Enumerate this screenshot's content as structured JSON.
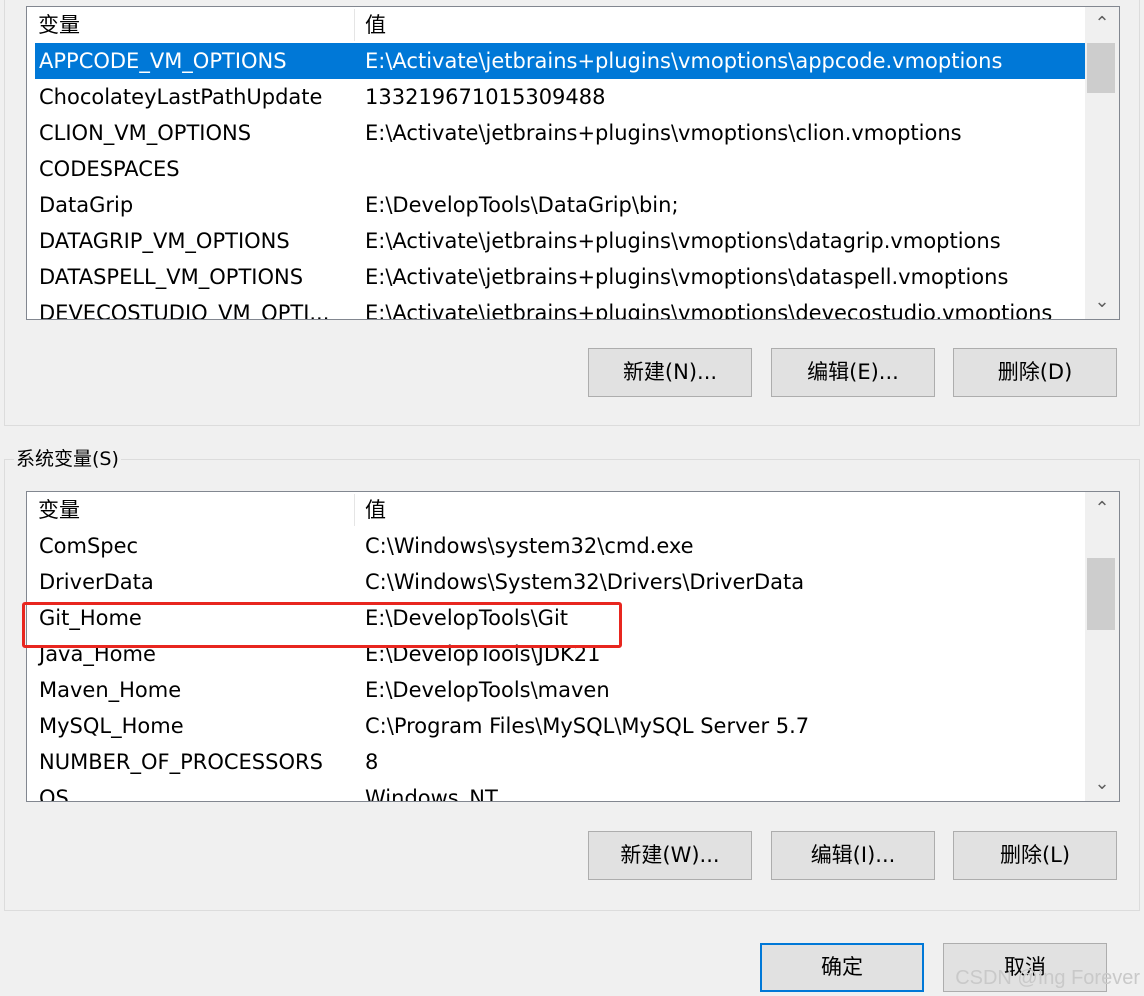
{
  "user_vars": {
    "header": {
      "name": "变量",
      "value": "值"
    },
    "rows": [
      {
        "name": "APPCODE_VM_OPTIONS",
        "value": "E:\\Activate\\jetbrains+plugins\\vmoptions\\appcode.vmoptions"
      },
      {
        "name": "ChocolateyLastPathUpdate",
        "value": "133219671015309488"
      },
      {
        "name": "CLION_VM_OPTIONS",
        "value": "E:\\Activate\\jetbrains+plugins\\vmoptions\\clion.vmoptions"
      },
      {
        "name": "CODESPACES",
        "value": ""
      },
      {
        "name": "DataGrip",
        "value": "E:\\DevelopTools\\DataGrip\\bin;"
      },
      {
        "name": "DATAGRIP_VM_OPTIONS",
        "value": "E:\\Activate\\jetbrains+plugins\\vmoptions\\datagrip.vmoptions"
      },
      {
        "name": "DATASPELL_VM_OPTIONS",
        "value": "E:\\Activate\\jetbrains+plugins\\vmoptions\\dataspell.vmoptions"
      },
      {
        "name": "DEVECOSTUDIO_VM_OPTI...",
        "value": "E:\\Activate\\jetbrains+plugins\\vmoptions\\devecostudio.vmoptions"
      }
    ],
    "buttons": {
      "new": "新建(N)...",
      "edit": "编辑(E)...",
      "delete": "删除(D)"
    }
  },
  "system_vars": {
    "group_label": "系统变量(S)",
    "header": {
      "name": "变量",
      "value": "值"
    },
    "rows": [
      {
        "name": "ComSpec",
        "value": "C:\\Windows\\system32\\cmd.exe"
      },
      {
        "name": "DriverData",
        "value": "C:\\Windows\\System32\\Drivers\\DriverData"
      },
      {
        "name": "Git_Home",
        "value": "E:\\DevelopTools\\Git"
      },
      {
        "name": "Java_Home",
        "value": "E:\\DevelopTools\\JDK21"
      },
      {
        "name": "Maven_Home",
        "value": "E:\\DevelopTools\\maven"
      },
      {
        "name": "MySQL_Home",
        "value": "C:\\Program Files\\MySQL\\MySQL Server 5.7"
      },
      {
        "name": "NUMBER_OF_PROCESSORS",
        "value": "8"
      },
      {
        "name": "OS",
        "value": "Windows_NT"
      }
    ],
    "buttons": {
      "new": "新建(W)...",
      "edit": "编辑(I)...",
      "delete": "删除(L)"
    }
  },
  "dialog_buttons": {
    "ok": "确定",
    "cancel": "取消"
  },
  "watermark": "CSDN @Ing Forever",
  "colors": {
    "selection": "#0078d7",
    "highlight_box": "#e8261f"
  }
}
